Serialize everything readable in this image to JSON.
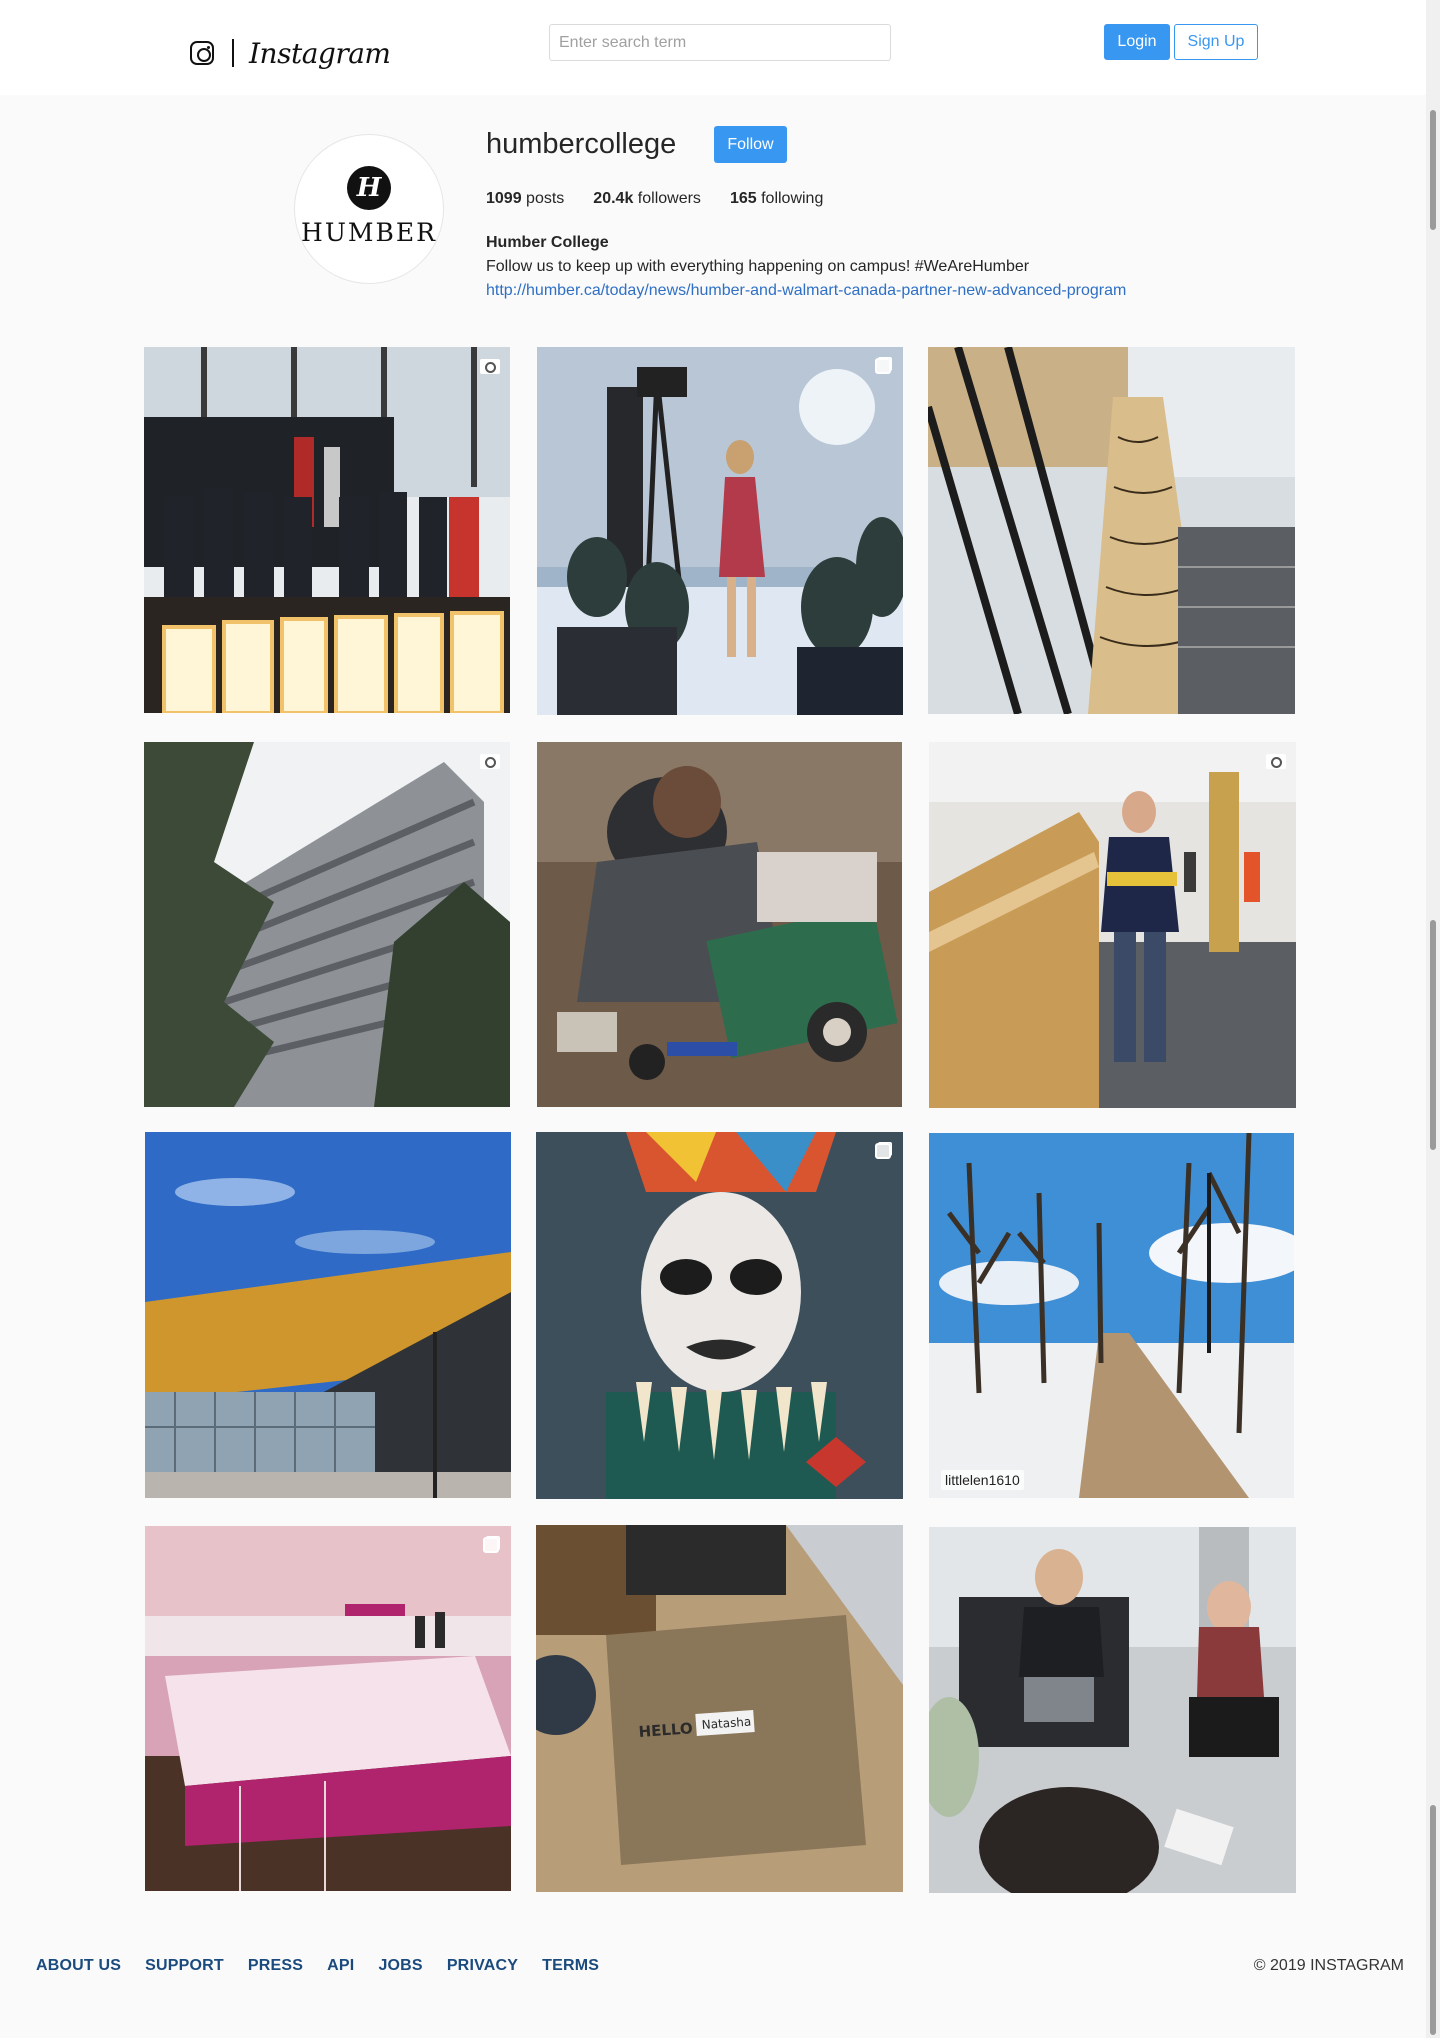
{
  "header": {
    "logo_text": "Instagram",
    "search_placeholder": "Enter search term",
    "login_label": "Login",
    "signup_label": "Sign Up"
  },
  "profile": {
    "username": "humbercollege",
    "follow_label": "Follow",
    "avatar_word": "HUMBER",
    "avatar_monogram": "H",
    "posts_count": "1099",
    "posts_label": "posts",
    "followers_count": "20.4k",
    "followers_label": "followers",
    "following_count": "165",
    "following_label": "following",
    "full_name": "Humber College",
    "bio": "Follow us to keep up with everything happening on campus! #WeAreHumber",
    "link": "http://humber.ca/today/news/humber-and-walmart-canada-partner-new-advanced-program"
  },
  "posts": [
    {
      "subject": "ceremony-stage",
      "badge": "video-icon"
    },
    {
      "subject": "fashion-runway",
      "badge": "multi-photo-icon"
    },
    {
      "subject": "wooden-sculpture",
      "badge": ""
    },
    {
      "subject": "building-exterior-trees",
      "badge": "video-icon"
    },
    {
      "subject": "workbench-maker",
      "badge": ""
    },
    {
      "subject": "student-hallway",
      "badge": "video-icon"
    },
    {
      "subject": "arena-blue-sky",
      "badge": ""
    },
    {
      "subject": "indigenous-portrait",
      "badge": "multi-photo-icon"
    },
    {
      "subject": "snowy-path",
      "badge": "",
      "watermark": "littlelen1610"
    },
    {
      "subject": "pink-installation",
      "badge": "multi-photo-icon"
    },
    {
      "subject": "hello-envelope",
      "badge": "",
      "caption_a": "HELLO",
      "caption_b": "Natasha"
    },
    {
      "subject": "students-seating",
      "badge": ""
    }
  ],
  "footer": {
    "links": [
      "ABOUT US",
      "SUPPORT",
      "PRESS",
      "API",
      "JOBS",
      "PRIVACY",
      "TERMS"
    ],
    "copyright": "© 2019 INSTAGRAM"
  },
  "colors": {
    "accent": "#3897f0",
    "link": "#2f6fc4",
    "footer_link": "#1b4a7e",
    "background": "#fafafa"
  }
}
